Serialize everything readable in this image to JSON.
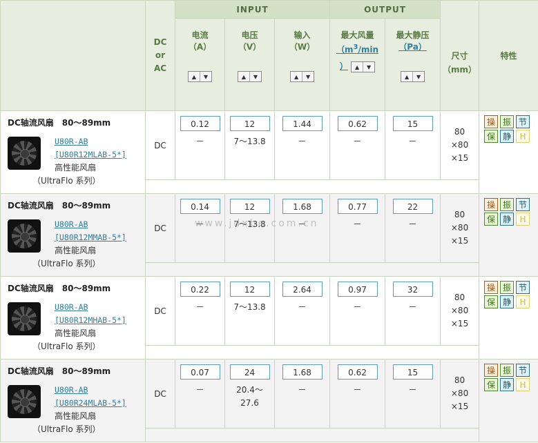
{
  "header": {
    "group_input": "INPUT",
    "group_output": "OUTPUT",
    "dc_or_ac": [
      "DC",
      "or",
      "AC"
    ],
    "current": [
      "电流",
      "（A）"
    ],
    "voltage": [
      "电压",
      "（V）"
    ],
    "power": [
      "输入",
      "（W）"
    ],
    "airflow_label": "最大风量",
    "airflow_unit_pre": "（m",
    "airflow_unit_sup": "3",
    "airflow_unit_post": "/min",
    "airflow_unit_close": "）",
    "pressure_label": "最大静压",
    "pressure_unit": "（Pa）",
    "size": [
      "尺寸",
      "（mm）"
    ],
    "features": "特性",
    "sort_up": "▲",
    "sort_down": "▼"
  },
  "rows": [
    {
      "title": "DC轴流风扇　80～89mm",
      "model_line1": "U80R-AB",
      "model_line2": "[U80R12MLAB-5*]",
      "desc": "高性能风扇",
      "series": "（UltraFlo 系列）",
      "dc": "DC",
      "current": "0.12",
      "current_sub": "－",
      "voltage": "12",
      "voltage_sub": "7～13.8",
      "power": "1.44",
      "power_sub": "－",
      "airflow": "0.62",
      "airflow_sub": "－",
      "pressure": "15",
      "pressure_sub": "－",
      "size": [
        "80",
        "×80",
        "×15"
      ]
    },
    {
      "title": "DC轴流风扇　80～89mm",
      "model_line1": "U80R-AB",
      "model_line2": "[U80R12MMAB-5*]",
      "desc": "高性能风扇",
      "series": "（UltraFlo 系列）",
      "dc": "DC",
      "current": "0.14",
      "current_sub": "－",
      "voltage": "12",
      "voltage_sub": "7～13.8",
      "power": "1.68",
      "power_sub": "－",
      "airflow": "0.77",
      "airflow_sub": "－",
      "pressure": "22",
      "pressure_sub": "－",
      "size": [
        "80",
        "×80",
        "×15"
      ]
    },
    {
      "title": "DC轴流风扇　80～89mm",
      "model_line1": "U80R-AB",
      "model_line2": "[U80R12MHAB-5*]",
      "desc": "高性能风扇",
      "series": "（UltraFlo 系列）",
      "dc": "DC",
      "current": "0.22",
      "current_sub": "－",
      "voltage": "12",
      "voltage_sub": "7～13.8",
      "power": "2.64",
      "power_sub": "－",
      "airflow": "0.97",
      "airflow_sub": "－",
      "pressure": "32",
      "pressure_sub": "－",
      "size": [
        "80",
        "×80",
        "×15"
      ]
    },
    {
      "title": "DC轴流风扇　80～89mm",
      "model_line1": "U80R-AB",
      "model_line2": "[U80R24MLAB-5*]",
      "desc": "高性能风扇",
      "series": "（UltraFlo 系列）",
      "dc": "DC",
      "current": "0.07",
      "current_sub": "－",
      "voltage": "24",
      "voltage_sub": "20.4～\n27.6",
      "power": "1.68",
      "power_sub": "－",
      "airflow": "0.62",
      "airflow_sub": "－",
      "pressure": "15",
      "pressure_sub": "－",
      "size": [
        "80",
        "×80",
        "×15"
      ]
    }
  ],
  "badges": [
    "操",
    "振",
    "节",
    "保",
    "静",
    "H"
  ],
  "watermark": "www.jdxbe.com.cn",
  "colors": {
    "header_bg": "#e7eedf",
    "group_bg": "#d3e2c6",
    "link": "#2e7fa0",
    "box_border": "#5aa0bd"
  }
}
